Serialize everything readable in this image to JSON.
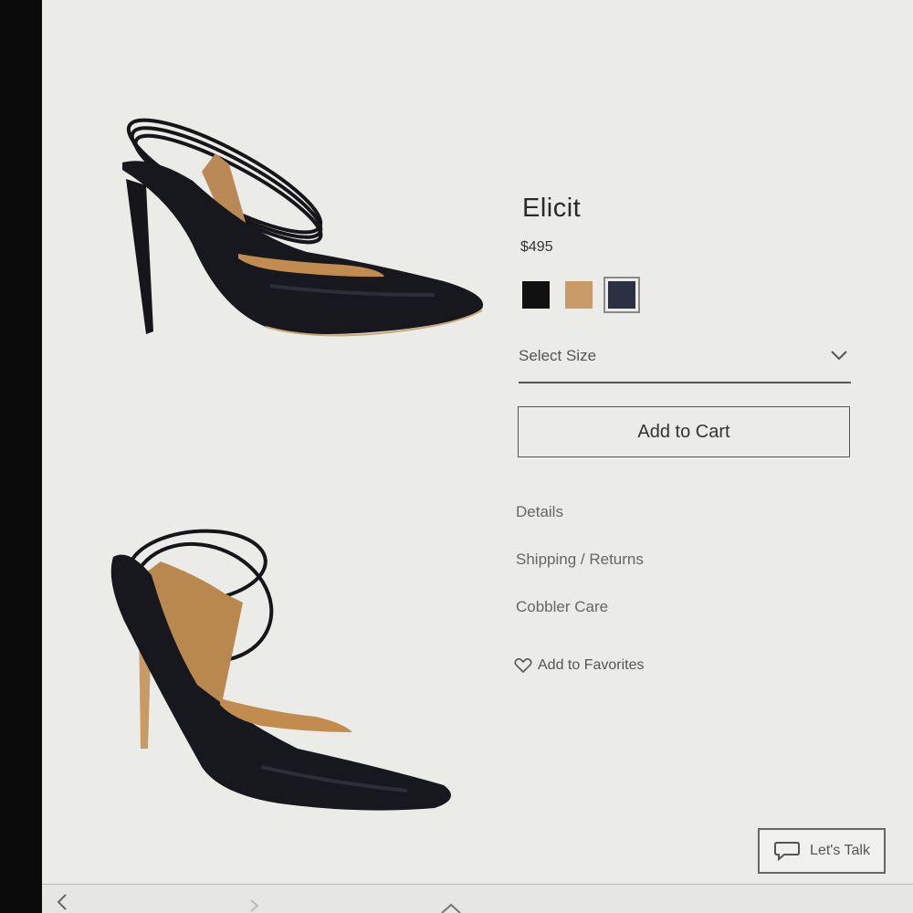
{
  "product": {
    "title": "Elicit",
    "price": "$495",
    "swatches": [
      {
        "name": "black",
        "color": "#111111"
      },
      {
        "name": "tan",
        "color": "#c89b68"
      },
      {
        "name": "navy",
        "color": "#2a3142",
        "selected": true
      }
    ]
  },
  "size_select": {
    "label": "Select Size"
  },
  "add_to_cart": {
    "label": "Add to Cart"
  },
  "links": {
    "details": "Details",
    "shipping": "Shipping / Returns",
    "care": "Cobbler Care"
  },
  "favorites": {
    "label": "Add to Favorites"
  },
  "chat": {
    "label": "Let's Talk"
  },
  "icons": {
    "chevron": "chevron-down-icon",
    "heart": "heart-icon",
    "chat": "chat-bubble-icon",
    "back": "back-arrow-icon",
    "forward": "forward-arrow-icon"
  }
}
